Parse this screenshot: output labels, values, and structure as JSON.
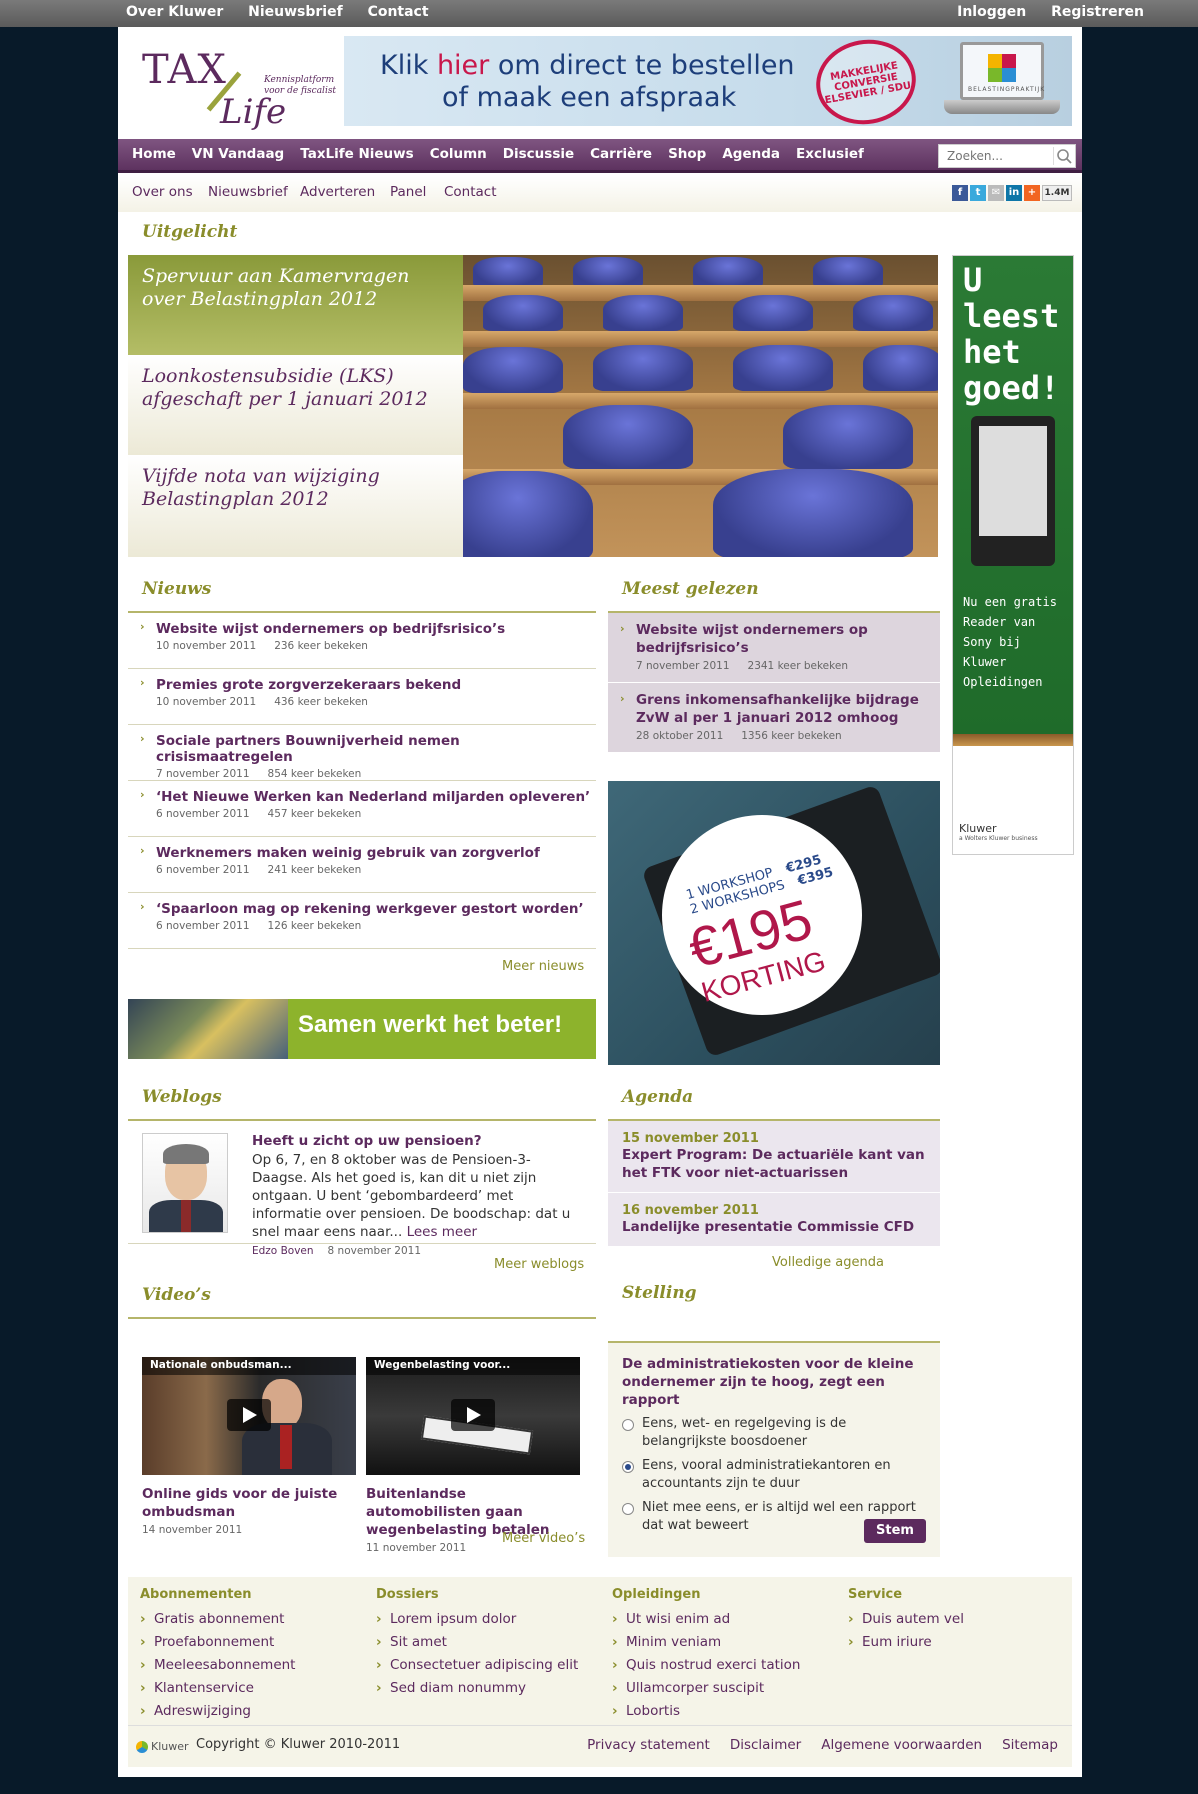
{
  "topbar": {
    "left": [
      "Over Kluwer",
      "Nieuwsbrief",
      "Contact"
    ],
    "right": [
      "Inloggen",
      "Registreren"
    ]
  },
  "logo": {
    "word1": "TAX",
    "word2": "Life",
    "tagline": "Kennisplatform voor de fiscalist"
  },
  "banner": {
    "line1_a": "Klik ",
    "line1_b": "hier",
    "line1_c": " om direct te bestellen",
    "line2": "of maak een afspraak",
    "stamp": "MAKKELIJKE CONVERSIE ELSEVIER / SDU",
    "product": "BELASTINGPRAKTIJK"
  },
  "mainnav": [
    "Home",
    "VN Vandaag",
    "TaxLife Nieuws",
    "Column",
    "Discussie",
    "Carrière",
    "Shop",
    "Agenda",
    "Exclusief"
  ],
  "search": {
    "placeholder": "Zoeken..."
  },
  "subnav": [
    "Over ons",
    "Nieuwsbrief",
    "Adverteren",
    "Panel",
    "Contact"
  ],
  "share": {
    "count": "1.4M"
  },
  "uitgelicht": {
    "title": "Uitgelicht",
    "items": [
      "Spervuur aan Kamervragen over Belastingplan 2012",
      "Loonkostensubsidie (LKS) afgeschaft per 1 januari 2012",
      "Vijfde nota van wijziging Belastingplan 2012"
    ]
  },
  "ad_right": {
    "hand": "U leest het goed!",
    "small": "Nu een gratis Reader van Sony bij Kluwer Opleidingen",
    "brand": "Kluwer",
    "brand_sub": "a Wolters Kluwer business"
  },
  "nieuws": {
    "title": "Nieuws",
    "items": [
      {
        "title": "Website wijst ondernemers op bedrijfsrisico’s",
        "date": "10 november 2011",
        "views": "236 keer bekeken"
      },
      {
        "title": "Premies grote zorgverzekeraars bekend",
        "date": "10 november 2011",
        "views": "436 keer bekeken"
      },
      {
        "title": "Sociale partners Bouwnijverheid nemen crisismaatregelen",
        "date": "7 november 2011",
        "views": "854 keer bekeken"
      },
      {
        "title": "‘Het Nieuwe Werken kan Nederland miljarden opleveren’",
        "date": "6 november 2011",
        "views": "457 keer bekeken"
      },
      {
        "title": "Werknemers maken weinig gebruik van zorgverlof",
        "date": "6 november 2011",
        "views": "241 keer bekeken"
      },
      {
        "title": "‘Spaarloon mag op rekening werkgever gestort worden’",
        "date": "6 november 2011",
        "views": "126 keer bekeken"
      }
    ],
    "more": "Meer nieuws"
  },
  "meest_gelezen": {
    "title": "Meest gelezen",
    "items": [
      {
        "title": "Website wijst ondernemers op bedrijfsrisico’s",
        "date": "7 november 2011",
        "views": "2341 keer bekeken"
      },
      {
        "title": "Grens inkomensafhankelijke bijdrage ZvW al per 1 januari 2012 omhoog",
        "date": "28 oktober 2011",
        "views": "1356 keer bekeken"
      }
    ]
  },
  "workshop": {
    "l1": "1 WORKSHOP",
    "p1": "€295",
    "l2": "2 WORKSHOPS",
    "p2": "€395",
    "price": "€195",
    "korting": "KORTING"
  },
  "samen": {
    "text": "Samen werkt het beter!"
  },
  "weblogs": {
    "title": "Weblogs",
    "post_title": "Heeft u zicht op uw pensioen?",
    "text": "Op 6, 7, en 8 oktober was de Pensioen-3-Daagse. Als het goed is, kan dit u niet zijn ontgaan. U bent ‘gebombardeerd’ met informatie over pensioen. De boodschap: dat u snel maar eens naar...",
    "lees": "Lees meer",
    "author": "Edzo Boven",
    "date": "8 november 2011",
    "more": "Meer weblogs"
  },
  "agenda": {
    "title": "Agenda",
    "items": [
      {
        "date": "15 november 2011",
        "title": "Expert Program: De actuariële kant van het FTK voor niet-actuarissen"
      },
      {
        "date": "16 november 2011",
        "title": "Landelijke presentatie Commissie CFD"
      }
    ],
    "more": "Volledige agenda"
  },
  "videos": {
    "title": "Video’s",
    "items": [
      {
        "caption": "Nationale onbudsman...",
        "title": "Online gids voor de juiste ombudsman",
        "date": "14 november 2011"
      },
      {
        "caption": "Wegenbelasting voor...",
        "title": "Buitenlandse automobilisten gaan wegenbelasting betalen",
        "date": "11 november 2011"
      }
    ],
    "more": "Meer video’s"
  },
  "stelling": {
    "title": "Stelling",
    "question": "De administratiekosten voor de kleine ondernemer zijn te hoog, zegt een rapport",
    "options": [
      "Eens, wet- en regelgeving is de belangrijkste boosdoener",
      "Eens, vooral administratiekantoren en accountants zijn te duur",
      "Niet mee eens, er is altijd wel een rapport dat wat beweert"
    ],
    "selected": 1,
    "button": "Stem"
  },
  "footer": {
    "cols": [
      {
        "h": "Abonnementen",
        "links": [
          "Gratis abonnement",
          "Proefabonnement",
          "Meeleesabonnement",
          "Klantenservice",
          "Adreswijziging"
        ]
      },
      {
        "h": "Dossiers",
        "links": [
          "Lorem ipsum dolor",
          "Sit amet",
          "Consectetuer adipiscing elit",
          "Sed diam nonummy"
        ]
      },
      {
        "h": "Opleidingen",
        "links": [
          "Ut wisi enim ad",
          "Minim veniam",
          "Quis nostrud exerci tation",
          "Ullamcorper suscipit",
          "Lobortis"
        ]
      },
      {
        "h": "Service",
        "links": [
          "Duis autem vel",
          "Eum iriure"
        ]
      }
    ],
    "brand": "Kluwer",
    "copyright": "Copyright © Kluwer 2010-2011",
    "links": [
      "Privacy statement",
      "Disclaimer",
      "Algemene voorwaarden",
      "Sitemap"
    ]
  },
  "colors": {
    "purple": "#5c2a5e",
    "olive": "#8a8d2b",
    "navy_bg": "#081a29"
  }
}
